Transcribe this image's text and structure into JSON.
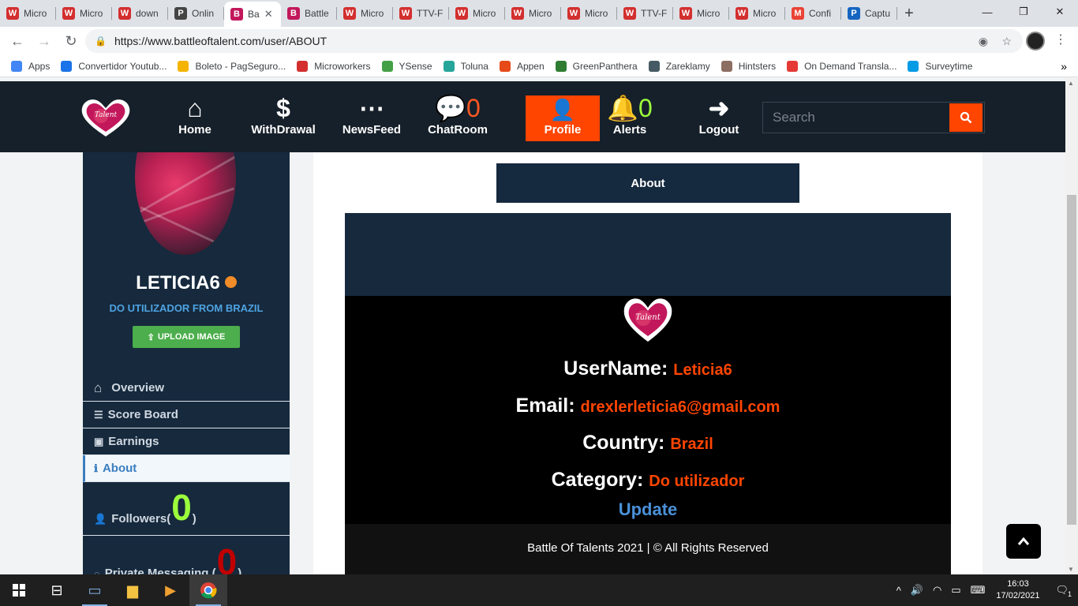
{
  "browser": {
    "tabs": [
      {
        "icon": "W",
        "color": "#d32f2f",
        "title": "Micro",
        "active": false
      },
      {
        "icon": "W",
        "color": "#d32f2f",
        "title": "Micro",
        "active": false
      },
      {
        "icon": "W",
        "color": "#d32f2f",
        "title": "down",
        "active": false
      },
      {
        "icon": "P",
        "color": "#444444",
        "title": "Onlin",
        "active": false
      },
      {
        "icon": "B",
        "color": "#c2185b",
        "title": "Ba",
        "active": true
      },
      {
        "icon": "B",
        "color": "#c2185b",
        "title": "Battle",
        "active": false
      },
      {
        "icon": "W",
        "color": "#d32f2f",
        "title": "Micro",
        "active": false
      },
      {
        "icon": "W",
        "color": "#d32f2f",
        "title": "TTV-F",
        "active": false
      },
      {
        "icon": "W",
        "color": "#d32f2f",
        "title": "Micro",
        "active": false
      },
      {
        "icon": "W",
        "color": "#d32f2f",
        "title": "Micro",
        "active": false
      },
      {
        "icon": "W",
        "color": "#d32f2f",
        "title": "Micro",
        "active": false
      },
      {
        "icon": "W",
        "color": "#d32f2f",
        "title": "TTV-F",
        "active": false
      },
      {
        "icon": "W",
        "color": "#d32f2f",
        "title": "Micro",
        "active": false
      },
      {
        "icon": "W",
        "color": "#d32f2f",
        "title": "Micro",
        "active": false
      },
      {
        "icon": "M",
        "color": "#ea4335",
        "title": "Confi",
        "active": false
      },
      {
        "icon": "P",
        "color": "#1565c0",
        "title": "Captu",
        "active": false
      }
    ],
    "url": "https://www.battleoftalent.com/user/ABOUT",
    "bookmarks": [
      {
        "label": "Apps",
        "icon": "apps-icon",
        "color": "#4285f4"
      },
      {
        "label": "Convertidor Youtub...",
        "icon": "youtube-icon",
        "color": "#1a73e8"
      },
      {
        "label": "Boleto - PagSeguro...",
        "icon": "pagseguro-icon",
        "color": "#f4b400"
      },
      {
        "label": "Microworkers",
        "icon": "microworkers-icon",
        "color": "#d32f2f"
      },
      {
        "label": "YSense",
        "icon": "ysense-icon",
        "color": "#43a047"
      },
      {
        "label": "Toluna",
        "icon": "toluna-icon",
        "color": "#26a69a"
      },
      {
        "label": "Appen",
        "icon": "appen-icon",
        "color": "#e64a19"
      },
      {
        "label": "GreenPanthera",
        "icon": "greenpanthera-icon",
        "color": "#2e7d32"
      },
      {
        "label": "Zareklamy",
        "icon": "zareklamy-icon",
        "color": "#455a64"
      },
      {
        "label": "Hintsters",
        "icon": "hintsters-icon",
        "color": "#8d6e63"
      },
      {
        "label": "On Demand Transla...",
        "icon": "translation-icon",
        "color": "#e53935"
      },
      {
        "label": "Surveytime",
        "icon": "surveytime-icon",
        "color": "#039be5"
      }
    ]
  },
  "nav": {
    "items": [
      {
        "key": "home",
        "label": "Home",
        "icon": "⌂",
        "count": ""
      },
      {
        "key": "withdrawal",
        "label": "WithDrawal",
        "icon": "$",
        "count": ""
      },
      {
        "key": "newsfeed",
        "label": "NewsFeed",
        "icon": "⋯",
        "count": ""
      },
      {
        "key": "chatroom",
        "label": "ChatRoom",
        "icon": "💬",
        "count": "0"
      },
      {
        "key": "profile",
        "label": "Profile",
        "icon": "👤",
        "count": ""
      },
      {
        "key": "alerts",
        "label": "Alerts",
        "icon": "🔔",
        "count": "0"
      },
      {
        "key": "logout",
        "label": "Logout",
        "icon": "➜",
        "count": ""
      }
    ],
    "search_placeholder": "Search",
    "accent": "#ff4500"
  },
  "sidebar": {
    "username": "LETICIA6",
    "subtitle": "DO UTILIZADOR FROM BRAZIL",
    "upload_label": "UPLOAD IMAGE",
    "menu": [
      {
        "label": "Overview"
      },
      {
        "label": "Score Board"
      },
      {
        "label": "Earnings"
      },
      {
        "label": "About"
      }
    ],
    "followers_label": "Followers(",
    "followers_count": "0",
    "followers_close": ")",
    "pm_label": "Private Messaging (",
    "pm_count": "0",
    "pm_close": ")"
  },
  "main": {
    "about_title": "About",
    "username_label": "UserName:",
    "username_value": "Leticia6",
    "email_label": "Email:",
    "email_value": "drexlerleticia6@gmail.com",
    "country_label": "Country:",
    "country_value": "Brazil",
    "category_label": "Category:",
    "category_value": "Do utilizador",
    "update_label": "Update",
    "footer": "Battle Of Talents 2021 | © All Rights Reserved"
  },
  "taskbar": {
    "time": "16:03",
    "date": "17/02/2021",
    "notification_count": "1"
  }
}
